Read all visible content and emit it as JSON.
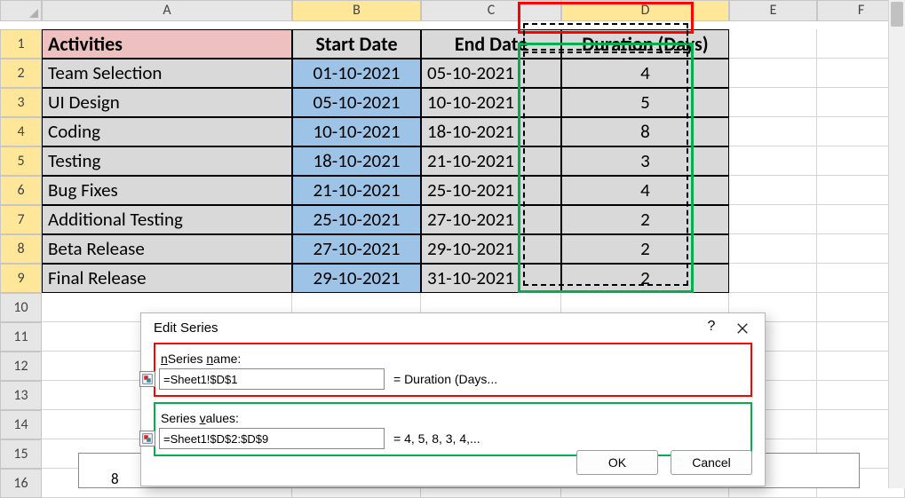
{
  "columns": [
    "A",
    "B",
    "C",
    "D",
    "E",
    "F"
  ],
  "rows": [
    "1",
    "2",
    "3",
    "4",
    "5",
    "6",
    "7",
    "8",
    "9",
    "10",
    "11",
    "12",
    "13",
    "14",
    "15",
    "16"
  ],
  "header": {
    "A": "Activities",
    "B": "Start Date",
    "C": "End Date",
    "D": "Duration (Days)"
  },
  "data": [
    {
      "A": "Team Selection",
      "B": "01-10-2021",
      "C": "05-10-2021",
      "D": "4"
    },
    {
      "A": "UI Design",
      "B": "05-10-2021",
      "C": "10-10-2021",
      "D": "5"
    },
    {
      "A": "Coding",
      "B": "10-10-2021",
      "C": "18-10-2021",
      "D": "8"
    },
    {
      "A": "Testing",
      "B": "18-10-2021",
      "C": "21-10-2021",
      "D": "3"
    },
    {
      "A": "Bug Fixes",
      "B": "21-10-2021",
      "C": "25-10-2021",
      "D": "4"
    },
    {
      "A": "Additional Testing",
      "B": "25-10-2021",
      "C": "27-10-2021",
      "D": "2"
    },
    {
      "A": "Beta Release",
      "B": "27-10-2021",
      "C": "29-10-2021",
      "D": "2"
    },
    {
      "A": "Final Release",
      "B": "29-10-2021",
      "C": "31-10-2021",
      "D": "2"
    }
  ],
  "dialog": {
    "title": "Edit Series",
    "name_label": "Series name:",
    "name_value": "=Sheet1!$D$1",
    "name_resolve": "= Duration (Days...",
    "values_label": "Series values:",
    "values_value": "=Sheet1!$D$2:$D$9",
    "values_resolve": "= 4, 5, 8, 3, 4,...",
    "ok": "OK",
    "cancel": "Cancel"
  },
  "chart_stub_value": "8",
  "chart_data": {
    "type": "bar",
    "title": "",
    "categories": [
      "Team Selection",
      "UI Design",
      "Coding",
      "Testing",
      "Bug Fixes",
      "Additional Testing",
      "Beta Release",
      "Final Release"
    ],
    "series": [
      {
        "name": "Duration (Days)",
        "values": [
          4,
          5,
          8,
          3,
          4,
          2,
          2,
          2
        ]
      }
    ],
    "xlabel": "",
    "ylabel": ""
  }
}
